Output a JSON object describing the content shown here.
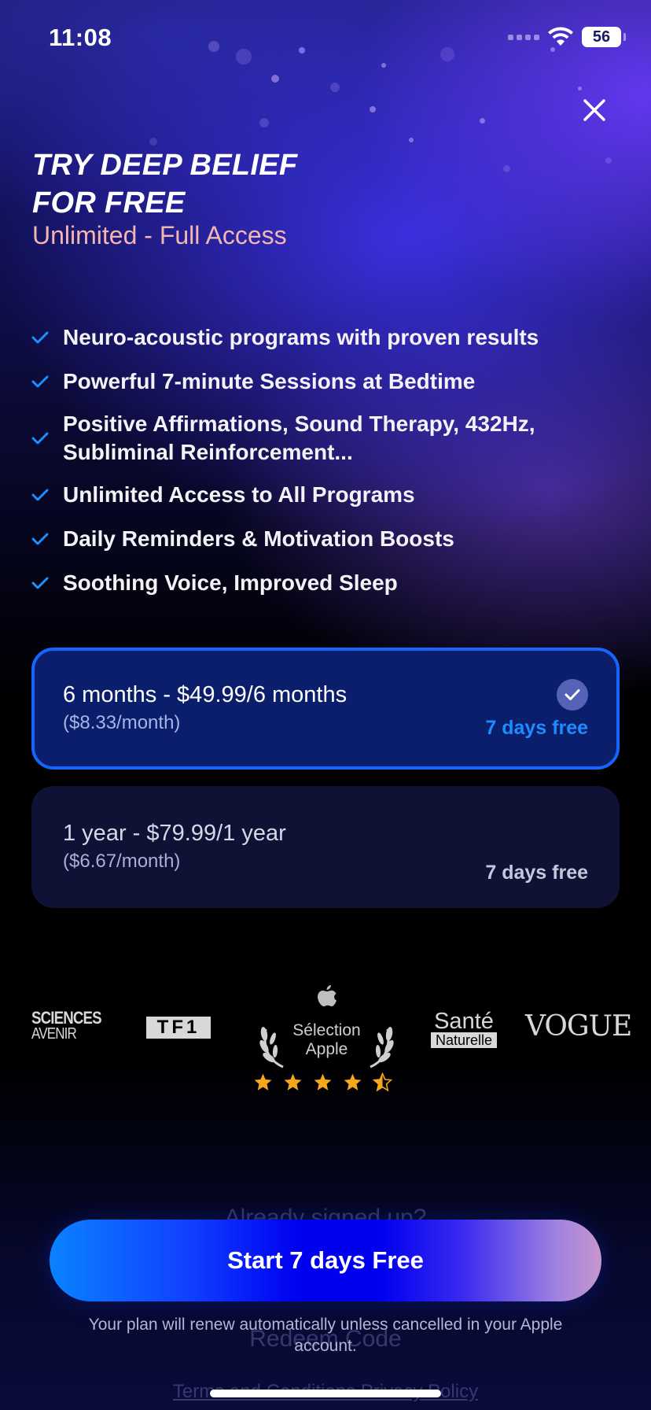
{
  "status_bar": {
    "time": "11:08",
    "battery": "56"
  },
  "header": {
    "title_line1": "TRY DEEP BELIEF",
    "title_line2": "FOR FREE",
    "subtitle": "Unlimited - Full Access"
  },
  "features": [
    {
      "text": "Neuro-acoustic programs with proven results"
    },
    {
      "text": "Powerful 7-minute Sessions at Bedtime"
    },
    {
      "text": "Positive Affirmations, Sound Therapy, 432Hz, Subliminal Reinforcement..."
    },
    {
      "text": "Unlimited Access to All Programs"
    },
    {
      "text": "Daily Reminders & Motivation Boosts"
    },
    {
      "text": "Soothing Voice, Improved Sleep"
    }
  ],
  "plans": [
    {
      "title": "6 months - $49.99/6 months",
      "per_month": "($8.33/month)",
      "trial": "7 days free",
      "selected": true
    },
    {
      "title": "1 year - $79.99/1 year",
      "per_month": "($6.67/month)",
      "trial": "7 days free",
      "selected": false
    }
  ],
  "press": {
    "sciences": "SCIENCES",
    "sciences_sub": "AVENIR",
    "tf1": "TF1",
    "apple_award_line1": "Sélection",
    "apple_award_line2": "Apple",
    "rating_stars": 4.5,
    "sante_line1": "Santé",
    "sante_line2": "Naturelle",
    "vogue": "VOGUE"
  },
  "behind_text": {
    "already": "Already signed up?",
    "redeem": "Redeem Code",
    "links": "Terms and Conditions  Privacy Policy"
  },
  "cta": {
    "label": "Start 7 days Free"
  },
  "disclaimer": "Your plan will renew automatically unless cancelled in your Apple account.",
  "colors": {
    "subtitle": "#f4b6b0",
    "check": "#1e8fff",
    "selected_border": "#1466ff",
    "trial_selected": "#1c8cff",
    "star": "#f5a81c"
  }
}
